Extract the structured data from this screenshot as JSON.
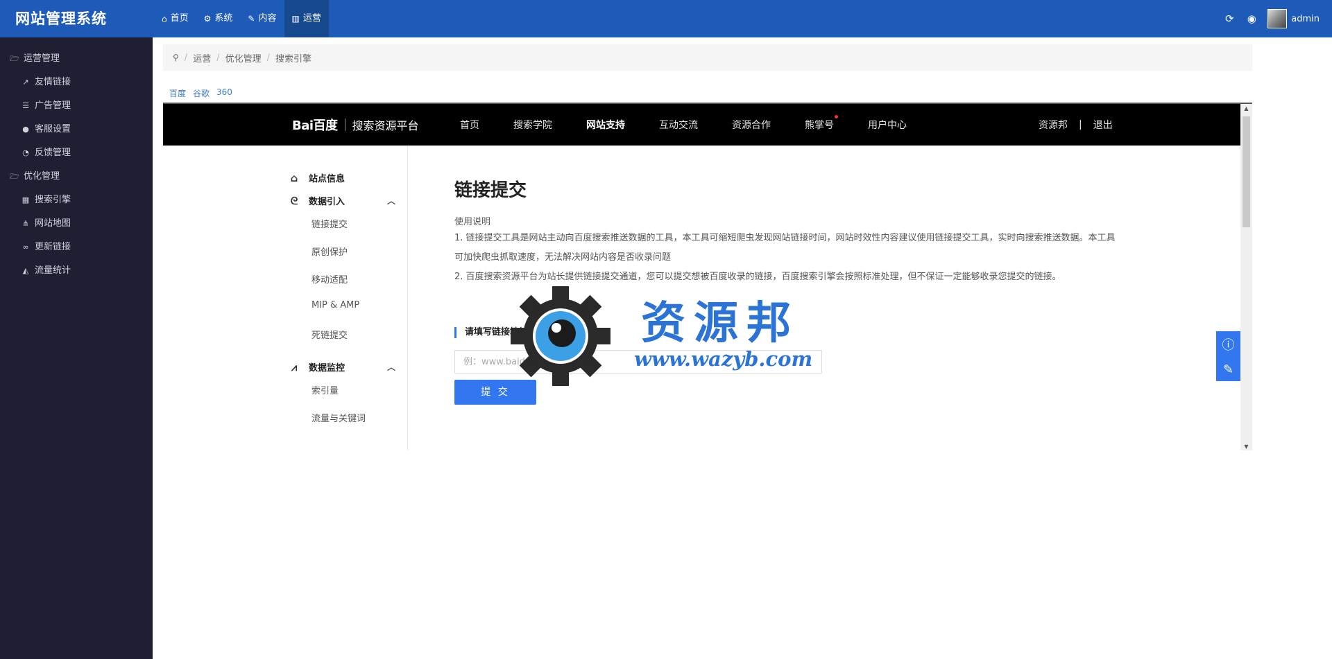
{
  "app": {
    "title": "网站管理系统",
    "user_name": "admin"
  },
  "topnav": [
    {
      "label": "首页",
      "icon": "home-icon",
      "glyph": "⌂",
      "active": false
    },
    {
      "label": "系统",
      "icon": "cogs-icon",
      "glyph": "⚙",
      "active": false
    },
    {
      "label": "内容",
      "icon": "edit-icon",
      "glyph": "✎",
      "active": false
    },
    {
      "label": "运营",
      "icon": "bar-chart-icon",
      "glyph": "▥",
      "active": true
    }
  ],
  "sidebar": {
    "groups": [
      {
        "label": "运营管理",
        "items": [
          "友情链接",
          "广告管理",
          "客服设置",
          "反馈管理"
        ]
      },
      {
        "label": "优化管理",
        "items": [
          "搜索引擎",
          "网站地图",
          "更新链接",
          "流量统计"
        ]
      }
    ]
  },
  "breadcrumb": [
    "运营",
    "优化管理",
    "搜索引擎"
  ],
  "engine_tabs": [
    "百度",
    "谷歌",
    "360"
  ],
  "baidu": {
    "logo_text": "Bai百度",
    "platform": "搜索资源平台",
    "nav": [
      "首页",
      "搜索学院",
      "网站支持",
      "互动交流",
      "资源合作",
      "熊掌号",
      "用户中心"
    ],
    "nav_active": "网站支持",
    "nav_badge_item": "熊掌号",
    "user": "资源邦",
    "separator": "|",
    "logout": "退出",
    "side": {
      "site_info": "站点信息",
      "data_import": "数据引入",
      "import_items": [
        "链接提交",
        "原创保护",
        "移动适配",
        "MIP & AMP",
        "死链提交"
      ],
      "data_monitor": "数据监控",
      "monitor_items": [
        "索引量",
        "流量与关键词"
      ]
    },
    "main": {
      "title": "链接提交",
      "usage_title": "使用说明",
      "para1": "1. 链接提交工具是网站主动向百度搜索推送数据的工具，本工具可缩短爬虫发现网站链接时间，网站时效性内容建议使用链接提交工具，实时向搜索推送数据。本工具可加快爬虫抓取速度，无法解决网站内容是否收录问题",
      "para2": "2. 百度搜索资源平台为站长提供链接提交通道，您可以提交想被百度收录的链接，百度搜索引擎会按照标准处理，但不保证一定能够收录您提交的链接。",
      "input_label": "请填写链接地址",
      "input_placeholder": "例：www.baidu.com",
      "submit": "提 交"
    }
  },
  "watermark": {
    "title": "资源邦",
    "url": "www.wazyb.com"
  },
  "colors": {
    "topbar": "#1e5bb8",
    "sidebar": "#1f1f33",
    "accent": "#3377f0"
  }
}
